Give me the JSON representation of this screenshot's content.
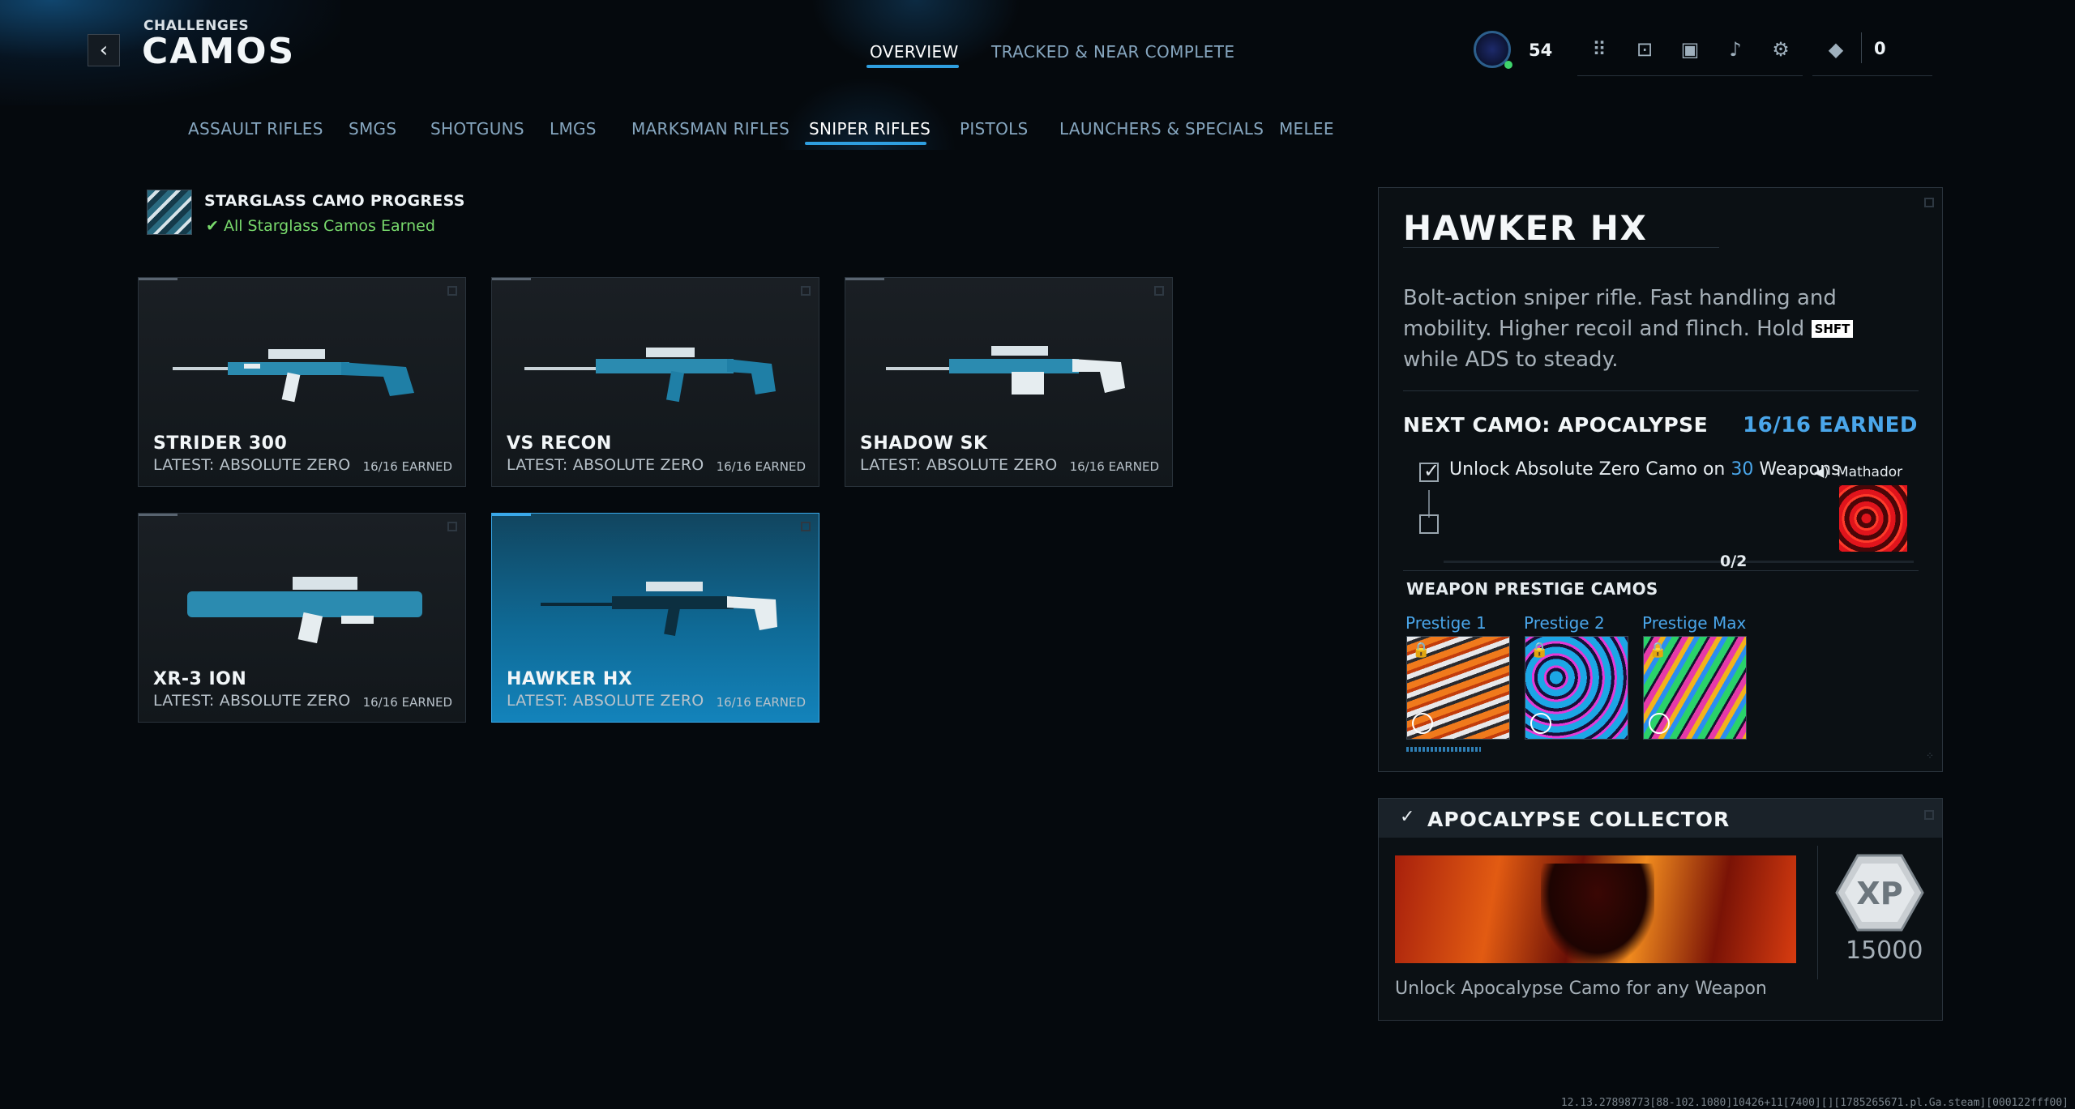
{
  "header": {
    "breadcrumb": "CHALLENGES",
    "title": "CAMOS",
    "back_icon": "chevron-left-icon"
  },
  "top_tabs": [
    {
      "label": "OVERVIEW",
      "active": true
    },
    {
      "label": "TRACKED & NEAR COMPLETE",
      "active": false
    }
  ],
  "hud": {
    "level": "54",
    "icons": [
      "grid-icon",
      "lock-icon",
      "mail-icon",
      "bell-icon",
      "gear-icon"
    ],
    "currency_icon": "cod-points-icon",
    "currency": "0"
  },
  "categories": [
    {
      "label": "ASSAULT RIFLES",
      "active": false
    },
    {
      "label": "SMGS",
      "active": false
    },
    {
      "label": "SHOTGUNS",
      "active": false
    },
    {
      "label": "LMGS",
      "active": false
    },
    {
      "label": "MARKSMAN RIFLES",
      "active": false
    },
    {
      "label": "SNIPER RIFLES",
      "active": true
    },
    {
      "label": "PISTOLS",
      "active": false
    },
    {
      "label": "LAUNCHERS & SPECIALS",
      "active": false
    },
    {
      "label": "MELEE",
      "active": false
    }
  ],
  "progress": {
    "title": "STARGLASS CAMO PROGRESS",
    "status": "✔ All Starglass Camos Earned"
  },
  "weapons": [
    {
      "name": "STRIDER 300",
      "latest": "LATEST: ABSOLUTE ZERO",
      "earned": "16/16 EARNED",
      "selected": false
    },
    {
      "name": "VS RECON",
      "latest": "LATEST: ABSOLUTE ZERO",
      "earned": "16/16 EARNED",
      "selected": false
    },
    {
      "name": "SHADOW SK",
      "latest": "LATEST: ABSOLUTE ZERO",
      "earned": "16/16 EARNED",
      "selected": false
    },
    {
      "name": "XR-3 ION",
      "latest": "LATEST: ABSOLUTE ZERO",
      "earned": "16/16 EARNED",
      "selected": false
    },
    {
      "name": "HAWKER HX",
      "latest": "LATEST: ABSOLUTE ZERO",
      "earned": "16/16 EARNED",
      "selected": true
    }
  ],
  "detail": {
    "title": "HAWKER HX",
    "desc_before": "Bolt-action sniper rifle.  Fast handling and mobility. Higher recoil and flinch. Hold ",
    "desc_key": "SHFT",
    "desc_after": " while ADS to steady.",
    "next_camo": "NEXT CAMO: APOCALYPSE",
    "next_earned": "16/16 EARNED",
    "challenge_before": "Unlock Absolute Zero Camo on ",
    "challenge_num": "30",
    "challenge_after": " Weapons",
    "reward_name": "Mathador",
    "challenge_progress": "0/2",
    "prestige_header": "WEAPON PRESTIGE CAMOS",
    "prestige": [
      {
        "label": "Prestige 1"
      },
      {
        "label": "Prestige 2"
      },
      {
        "label": "Prestige Max"
      }
    ]
  },
  "collector": {
    "title": "APOCALYPSE COLLECTOR",
    "xp_label": "XP",
    "xp_value": "15000",
    "description": "Unlock Apocalypse Camo for any Weapon"
  },
  "build_string": "12.13.27898773[88-102.1080]10426+11[7400][][1785265671.pl.Ga.steam][000122fff00]"
}
